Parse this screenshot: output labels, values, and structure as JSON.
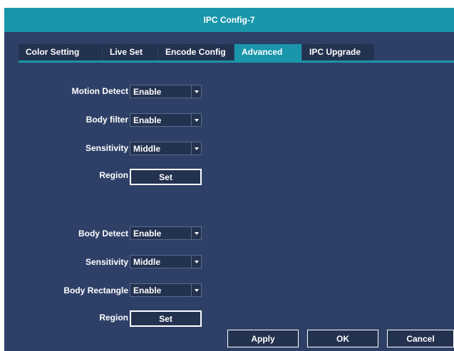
{
  "window": {
    "title": "IPC Config-7"
  },
  "tabs": [
    {
      "label": "Color Setting",
      "active": false
    },
    {
      "label": "Live Set",
      "active": false
    },
    {
      "label": "Encode Config",
      "active": false
    },
    {
      "label": "Advanced",
      "active": true
    },
    {
      "label": "IPC Upgrade",
      "active": false
    }
  ],
  "motion": {
    "motion_detect_label": "Motion Detect",
    "motion_detect_value": "Enable",
    "body_filter_label": "Body filter",
    "body_filter_value": "Enable",
    "sensitivity_label": "Sensitivity",
    "sensitivity_value": "Middle",
    "region_label": "Region",
    "region_button": "Set"
  },
  "body": {
    "body_detect_label": "Body Detect",
    "body_detect_value": "Enable",
    "sensitivity_label": "Sensitivity",
    "sensitivity_value": "Middle",
    "body_rectangle_label": "Body Rectangle",
    "body_rectangle_value": "Enable",
    "region_label": "Region",
    "region_button": "Set"
  },
  "footer": {
    "apply": "Apply",
    "ok": "OK",
    "cancel": "Cancel"
  },
  "colors": {
    "title_bar": "#1996aa",
    "panel": "#2f4068",
    "control": "#23324f"
  }
}
